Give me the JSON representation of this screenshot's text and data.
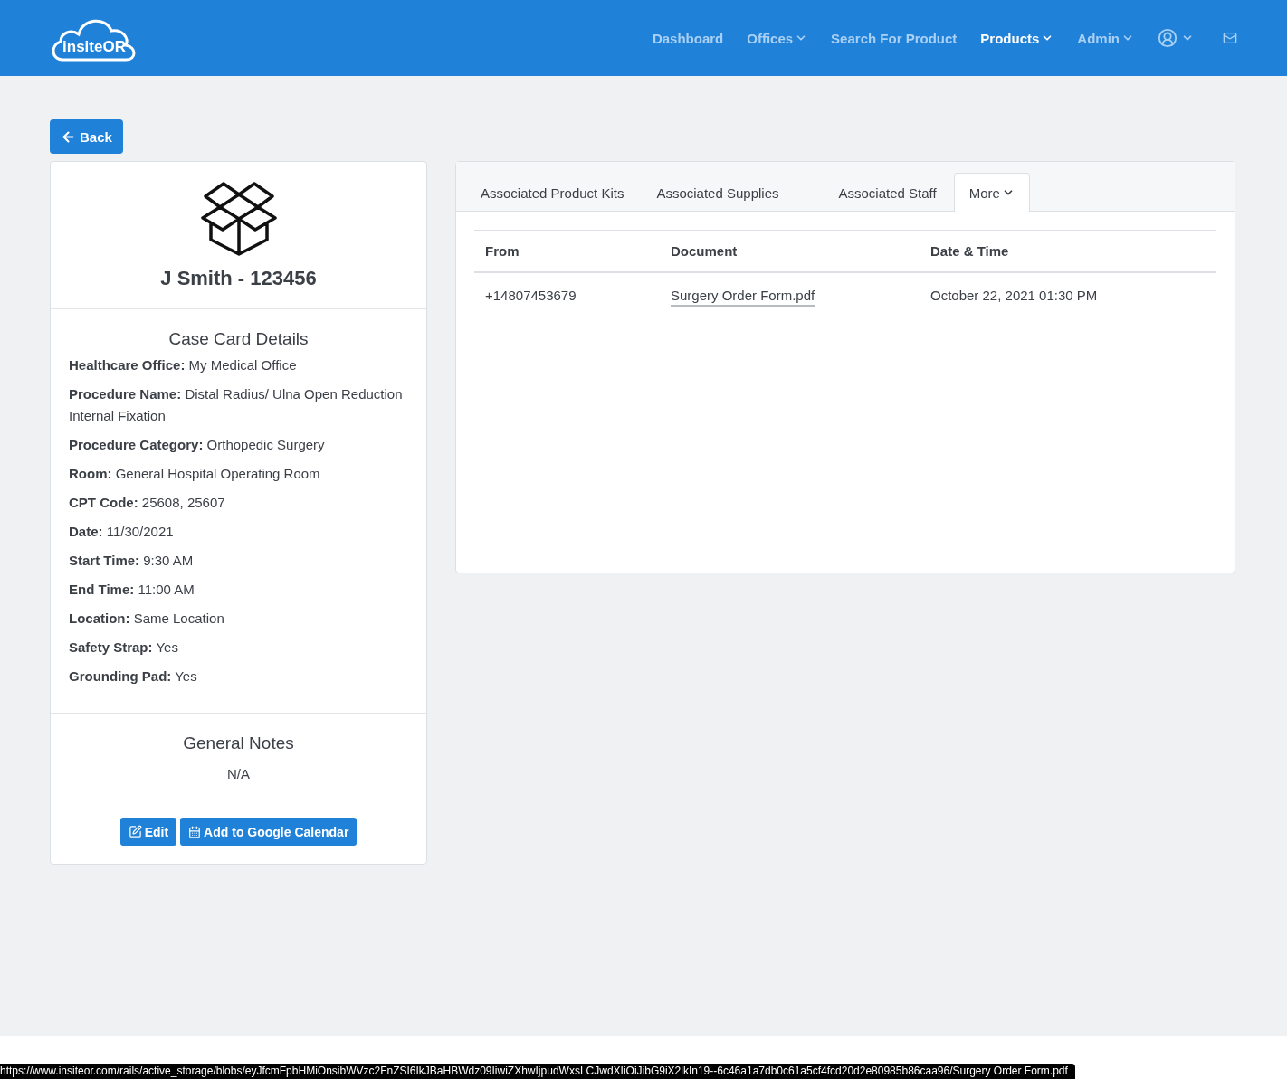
{
  "brand": "insiteOR",
  "nav": [
    {
      "label": "Dashboard",
      "dropdown": false,
      "selected": false
    },
    {
      "label": "Offices",
      "dropdown": true,
      "selected": false
    },
    {
      "label": "Search For Product",
      "dropdown": false,
      "selected": false
    },
    {
      "label": "Products",
      "dropdown": true,
      "selected": true
    },
    {
      "label": "Admin",
      "dropdown": true,
      "selected": false
    }
  ],
  "back_button": "Back",
  "case": {
    "title": "J Smith - 123456",
    "details_heading": "Case Card Details",
    "details": [
      {
        "label": "Healthcare Office:",
        "value": "My Medical Office"
      },
      {
        "label": "Procedure Name:",
        "value": "Distal Radius/ Ulna Open Reduction Internal Fixation"
      },
      {
        "label": "Procedure Category:",
        "value": "Orthopedic Surgery"
      },
      {
        "label": "Room:",
        "value": "General Hospital Operating Room"
      },
      {
        "label": "CPT Code:",
        "value": "25608, 25607"
      },
      {
        "label": "Date:",
        "value": "11/30/2021"
      },
      {
        "label": "Start Time:",
        "value": "9:30 AM"
      },
      {
        "label": "End Time:",
        "value": "11:00 AM"
      },
      {
        "label": "Location:",
        "value": "Same Location"
      },
      {
        "label": "Safety Strap:",
        "value": "Yes"
      },
      {
        "label": "Grounding Pad:",
        "value": "Yes"
      }
    ],
    "notes_heading": "General Notes",
    "notes": "N/A",
    "buttons": [
      {
        "kind": "edit",
        "label": "Edit"
      },
      {
        "kind": "calendar",
        "label": "Add to Google Calendar"
      }
    ]
  },
  "tabs": [
    {
      "label": "Associated Product Kits",
      "selected": false,
      "dropdown": false
    },
    {
      "label": "Associated Supplies",
      "selected": false,
      "dropdown": false
    },
    {
      "label": "Associated Staff",
      "selected": false,
      "dropdown": false
    },
    {
      "label": "More",
      "selected": true,
      "dropdown": true
    }
  ],
  "table": {
    "columns": [
      "From",
      "Document",
      "Date & Time"
    ],
    "rows": [
      {
        "from": "+14807453679",
        "document": "Surgery Order Form.pdf",
        "datetime": "October 22, 2021 01:30 PM"
      }
    ]
  },
  "status_bar": "https://www.insiteor.com/rails/active_storage/blobs/eyJfcmFpbHMiOnsibWVzc2FnZSI6IkJBaHBWdz09IiwiZXhwIjpudWxsLCJwdXIiOiJibG9iX2lkIn19--6c46a1a7db0c61a5cf4fcd20d2e80985b86caa96/Surgery Order Form.pdf"
}
